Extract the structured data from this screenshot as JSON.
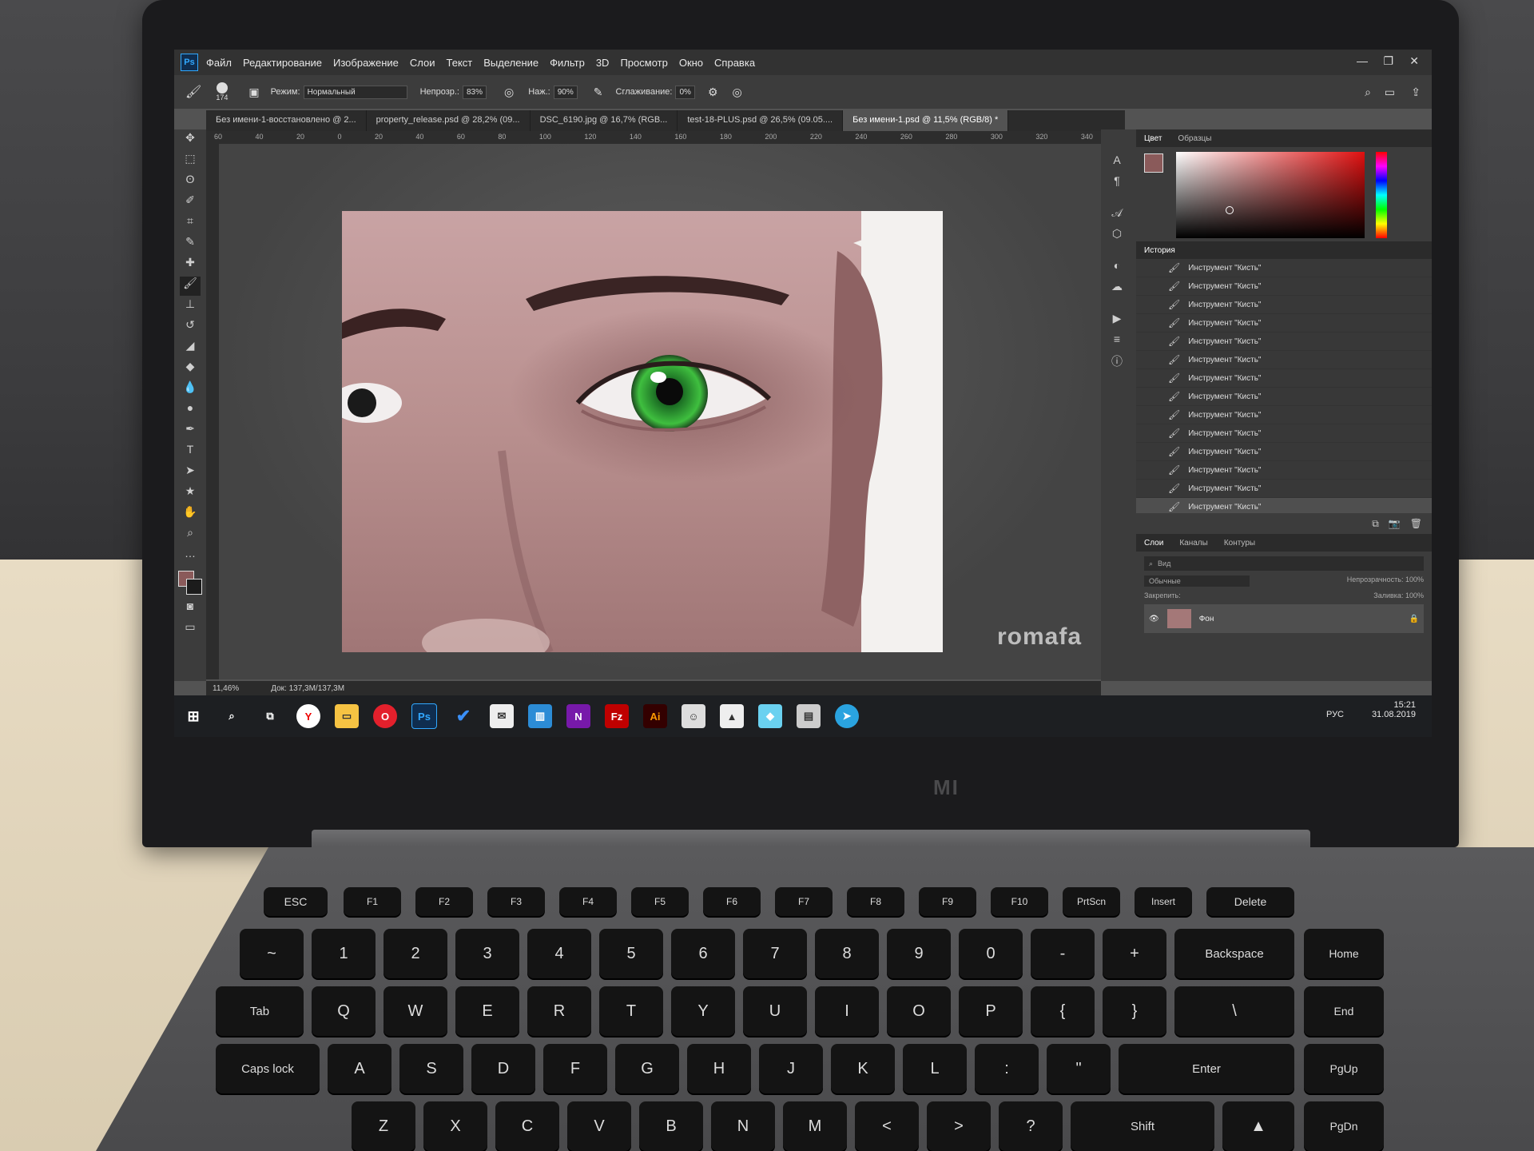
{
  "menu": {
    "items": [
      "Файл",
      "Редактирование",
      "Изображение",
      "Слои",
      "Текст",
      "Выделение",
      "Фильтр",
      "3D",
      "Просмотр",
      "Окно",
      "Справка"
    ]
  },
  "options": {
    "brush_size": "174",
    "mode_label": "Режим:",
    "mode_value": "Нормальный",
    "opacity_label": "Непрозр.:",
    "opacity_value": "83%",
    "pressure_label": "Наж.:",
    "pressure_value": "90%",
    "smoothing_label": "Сглаживание:",
    "smoothing_value": "0%"
  },
  "tabs": [
    "Без имени-1-восстановлено @ 2...",
    "property_release.psd @ 28,2% (09...",
    "DSC_6190.jpg @ 16,7% (RGB...",
    "test-18-PLUS.psd @ 26,5% (09.05....",
    "Без имени-1.psd @ 11,5% (RGB/8) *"
  ],
  "ruler_ticks": [
    "60",
    "40",
    "20",
    "0",
    "20",
    "40",
    "60",
    "80",
    "100",
    "120",
    "140",
    "160",
    "180",
    "200",
    "220",
    "240",
    "260",
    "280",
    "300",
    "320",
    "340"
  ],
  "color_panel": {
    "tabs": [
      "Цвет",
      "Образцы"
    ]
  },
  "history_panel": {
    "title": "История",
    "rows": [
      "Инструмент \"Кисть\"",
      "Инструмент \"Кисть\"",
      "Инструмент \"Кисть\"",
      "Инструмент \"Кисть\"",
      "Инструмент \"Кисть\"",
      "Инструмент \"Кисть\"",
      "Инструмент \"Кисть\"",
      "Инструмент \"Кисть\"",
      "Инструмент \"Кисть\"",
      "Инструмент \"Кисть\"",
      "Инструмент \"Кисть\"",
      "Инструмент \"Кисть\"",
      "Инструмент \"Кисть\"",
      "Инструмент \"Кисть\""
    ]
  },
  "layers_panel": {
    "tabs": [
      "Слои",
      "Каналы",
      "Контуры"
    ],
    "search_placeholder": "Вид",
    "blend": "Обычные",
    "opacity_label": "Непрозрачность:",
    "opacity_value": "100%",
    "lock_label": "Закрепить:",
    "fill_label": "Заливка:",
    "fill_value": "100%",
    "layer_name": "Фон"
  },
  "status": {
    "zoom": "11,46%",
    "doc": "Док: 137,3M/137,3M"
  },
  "watermark": "romafa",
  "taskbar": {
    "lang": "РУС",
    "time": "15:21",
    "date": "31.08.2019",
    "icons": [
      "windows-start",
      "search",
      "task-view",
      "yandex-browser",
      "file-explorer",
      "opera",
      "photoshop",
      "todo",
      "mail",
      "trello",
      "onenote",
      "filezilla",
      "illustrator",
      "app",
      "photos",
      "app",
      "app",
      "telegram"
    ]
  },
  "laptop": {
    "brand_logo": "MI"
  },
  "keyboard": {
    "fn_row": [
      "ESC",
      "F1",
      "F2",
      "F3",
      "F4",
      "F5",
      "F6",
      "F7",
      "F8",
      "F9",
      "F10",
      "PrtScn",
      "Insert",
      "Delete"
    ],
    "num_row": [
      "~",
      "1",
      "2",
      "3",
      "4",
      "5",
      "6",
      "7",
      "8",
      "9",
      "0",
      "-",
      "+",
      "Backspace",
      "Home"
    ],
    "top_row": [
      "Tab",
      "Q",
      "W",
      "E",
      "R",
      "T",
      "Y",
      "U",
      "I",
      "O",
      "P",
      "{",
      "}",
      "\\",
      "End"
    ],
    "home_row": [
      "Caps lock",
      "A",
      "S",
      "D",
      "F",
      "G",
      "H",
      "J",
      "K",
      "L",
      ":",
      "\"",
      "Enter",
      "PgUp"
    ],
    "bottom_row": [
      "Z",
      "X",
      "C",
      "V",
      "B",
      "N",
      "M",
      "<",
      ">",
      "?",
      "Shift",
      "▲",
      "PgDn"
    ]
  }
}
